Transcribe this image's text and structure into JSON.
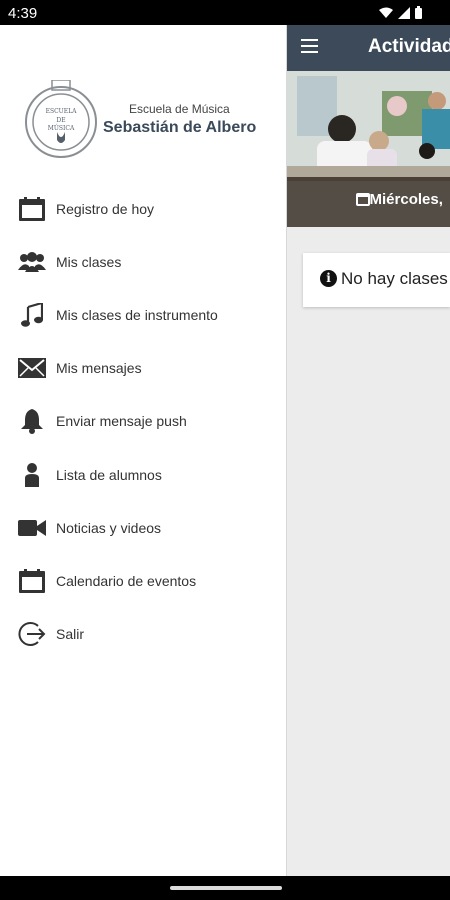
{
  "status": {
    "time": "4:39"
  },
  "app": {
    "title": "Actividad",
    "banner_date": "Miércoles,",
    "empty_message": "No hay clases"
  },
  "drawer": {
    "school_line1": "Escuela de Música",
    "school_line2": "Sebastián de Albero",
    "logo_text_top": "ESCUELA",
    "logo_text_mid": "DE",
    "logo_text_bottom": "MÚSICA",
    "items": [
      {
        "label": "Registro de hoy",
        "icon": "calendar-icon"
      },
      {
        "label": "Mis clases",
        "icon": "group-icon"
      },
      {
        "label": "Mis clases de instrumento",
        "icon": "music-note-icon"
      },
      {
        "label": "Mis mensajes",
        "icon": "envelope-icon"
      },
      {
        "label": "Enviar mensaje push",
        "icon": "bell-icon"
      },
      {
        "label": "Lista de alumnos",
        "icon": "person-icon"
      },
      {
        "label": "Noticias y videos",
        "icon": "video-camera-icon"
      },
      {
        "label": "Calendario de eventos",
        "icon": "calendar-icon"
      },
      {
        "label": "Salir",
        "icon": "logout-icon"
      }
    ]
  },
  "colors": {
    "toolbar": "#3c4a5a",
    "school_name": "#3a4a5a",
    "background": "#ececec"
  }
}
